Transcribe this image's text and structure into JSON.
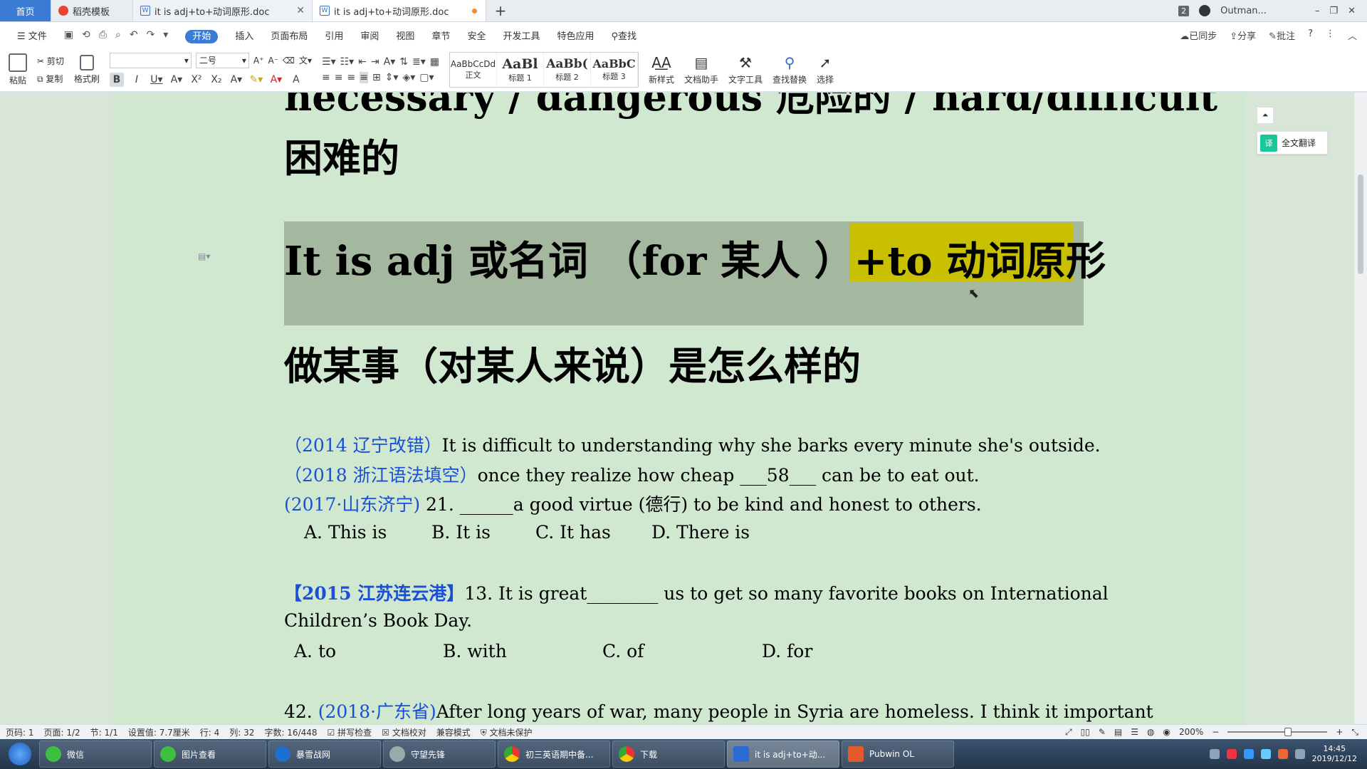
{
  "tabs": {
    "home": "首页",
    "template": "稻壳模板",
    "doc1": "it is adj+to+动词原形.doc",
    "doc2": "it is adj+to+动词原形.doc",
    "new_tab": "+"
  },
  "window": {
    "badge": "2",
    "user": "Outman...",
    "minimize": "–",
    "restore": "❐",
    "close": "✕"
  },
  "menu": {
    "file": "文件",
    "items": [
      "开始",
      "插入",
      "页面布局",
      "引用",
      "审阅",
      "视图",
      "章节",
      "安全",
      "开发工具",
      "特色应用"
    ],
    "search": "查找",
    "sync": "已同步",
    "share": "分享",
    "comment": "批注",
    "help": "?"
  },
  "ribbon": {
    "paste": "粘贴",
    "cut": "剪切",
    "copy": "复制",
    "format_painter": "格式刷",
    "font_size": "二号",
    "styles": [
      {
        "preview": "AaBbCcDd",
        "name": "正文"
      },
      {
        "preview": "AaBl",
        "name": "标题 1"
      },
      {
        "preview": "AaBb(",
        "name": "标题 2"
      },
      {
        "preview": "AaBbC",
        "name": "标题 3"
      }
    ],
    "new_style": "新样式",
    "doc_helper": "文档助手",
    "text_tools": "文字工具",
    "find_replace": "查找替换",
    "select": "选择"
  },
  "doc": {
    "line0": "necessary / dangerous 危险的 / hard/difficult",
    "line1": "困难的",
    "heading_a": "It is adj 或名词 （for 某人 ）+",
    "heading_b": "to 动词原形",
    "line3": "做某事（对某人来说）是怎么样的",
    "ex1_src": "（2014 辽宁改错）",
    "ex1_text": "It is difficult to understanding why she barks every minute she's outside.",
    "ex2_src": "（2018 浙江语法填空）",
    "ex2_text": "once they realize how cheap ___58___ can be to eat out.",
    "ex3_src": "(2017·山东济宁)",
    "ex3_text": " 21. ______a good virtue (德行) to be kind and honest to others.",
    "ex3_opts": [
      "A. This is",
      "B. It is",
      "C. It has",
      "D. There is"
    ],
    "ex4_src": "【2015 江苏连云港】",
    "ex4_text": "13. It is great________ us to get so many favorite books on International",
    "ex4_text2": "Children’s Book Day.",
    "ex4_opts": [
      "A. to",
      "B. with",
      "C. of",
      "D. for"
    ],
    "ex5_num": "42. ",
    "ex5_src": "(2018·广东省)",
    "ex5_text": "After long years of war, many people in Syria are homeless. I think it important"
  },
  "side": {
    "translate": "全文翻译"
  },
  "status": {
    "page_num": "页码: 1",
    "pages": "页面: 1/2",
    "section": "节: 1/1",
    "setting": "设置值: 7.7厘米",
    "row": "行: 4",
    "col": "列: 32",
    "words": "字数: 16/448",
    "spell": "拼写检查",
    "proof": "文档校对",
    "compat": "兼容模式",
    "protect": "文档未保护",
    "zoom": "200%"
  },
  "taskbar": {
    "items": [
      "微信",
      "图片查看",
      "暴雪战网",
      "守望先锋",
      "初三英语期中备...",
      "下载",
      "it is adj+to+动...",
      "Pubwin OL"
    ],
    "time": "14:45",
    "date": "2019/12/12"
  }
}
